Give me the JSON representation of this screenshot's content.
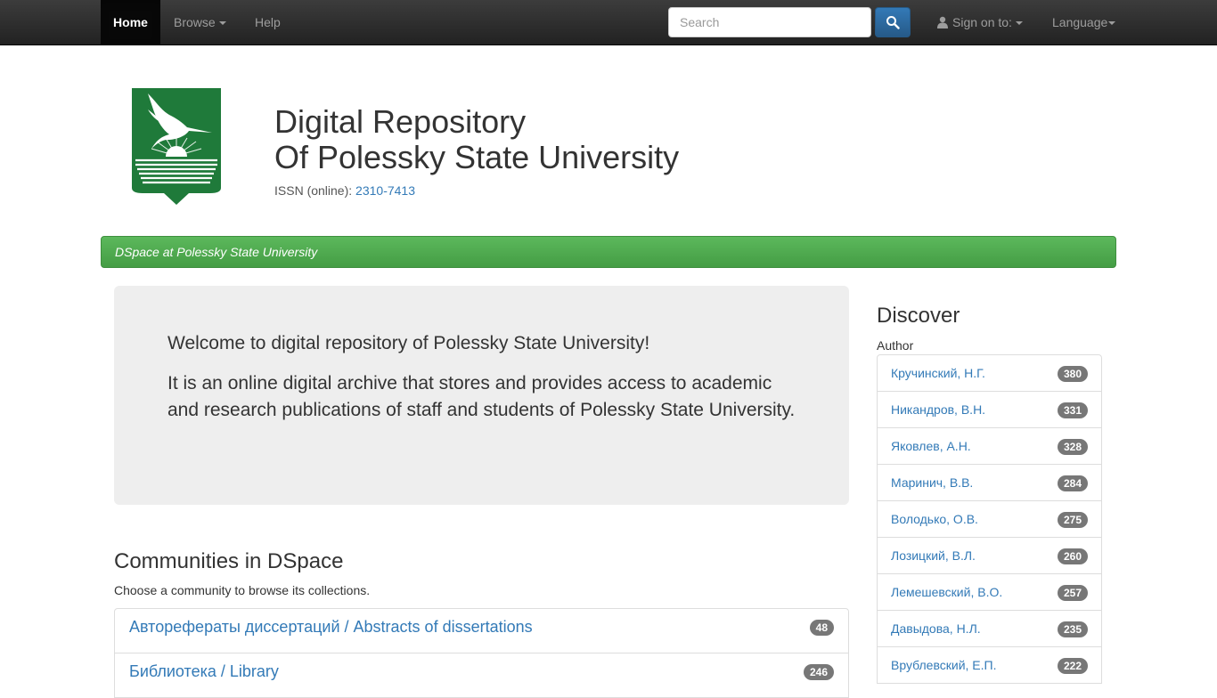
{
  "navbar": {
    "home": "Home",
    "browse": "Browse",
    "help": "Help",
    "search_placeholder": "Search",
    "signin": "Sign on to:",
    "language": "Language"
  },
  "header": {
    "title_line1": "Digital Repository",
    "title_line2": "Of Polessky State University",
    "issn_label": "ISSN (online): ",
    "issn_value": "2310-7413"
  },
  "breadcrumb": "DSpace at Polessky State University",
  "jumbotron": {
    "welcome": "Welcome to digital repository of Polessky State University!",
    "description": "It is an online digital archive that stores and provides access to academic and research publications of staff and students of Polessky State University."
  },
  "communities": {
    "title": "Communities in DSpace",
    "subtitle": "Choose a community to browse its collections.",
    "items": [
      {
        "label": "Авторефераты диссертаций / Abstracts of dissertations",
        "count": "48"
      },
      {
        "label": "Библиотека / Library",
        "count": "246"
      }
    ]
  },
  "discover": {
    "title": "Discover",
    "facet": "Author",
    "authors": [
      {
        "name": "Кручинский, Н.Г.",
        "count": "380"
      },
      {
        "name": "Никандров, В.Н.",
        "count": "331"
      },
      {
        "name": "Яковлев, А.Н.",
        "count": "328"
      },
      {
        "name": "Маринич, В.В.",
        "count": "284"
      },
      {
        "name": "Володько, О.В.",
        "count": "275"
      },
      {
        "name": "Лозицкий, В.Л.",
        "count": "260"
      },
      {
        "name": "Лемешевский, В.О.",
        "count": "257"
      },
      {
        "name": "Давыдова, Н.Л.",
        "count": "235"
      },
      {
        "name": "Врублевский, Е.П.",
        "count": "222"
      }
    ]
  },
  "colors": {
    "navbar": "#222222",
    "breadcrumb_green": "#5cb85c",
    "link": "#337ab7",
    "badge": "#777777",
    "logo_green": "#1f7a3a"
  }
}
